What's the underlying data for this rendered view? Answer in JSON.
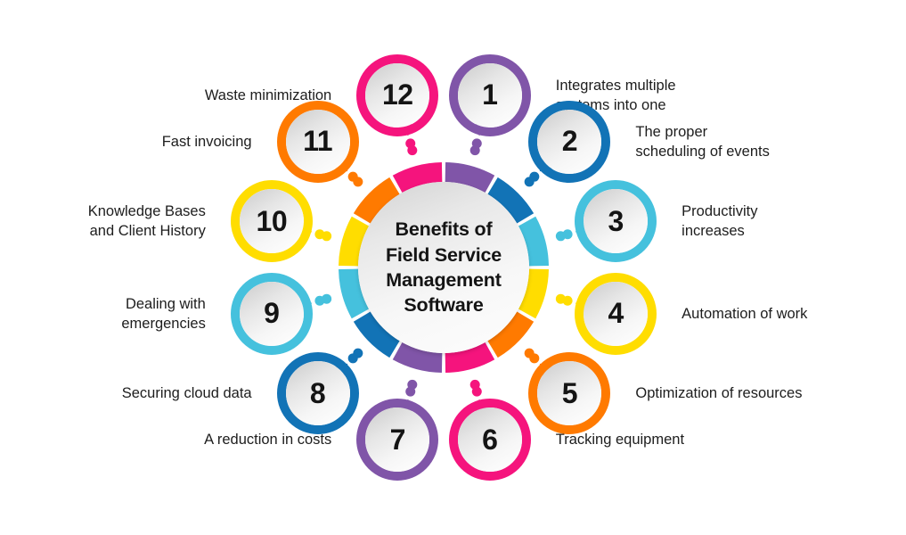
{
  "diagram": {
    "title_lines": "Benefits of\nField Service\nManagement\nSoftware",
    "palette": {
      "purple": "#8055a8",
      "blue": "#1273b6",
      "cyan": "#45c1dd",
      "yellow": "#ffdd00",
      "orange": "#ff7a00",
      "pink": "#f5147d"
    },
    "ring_segment_colors": [
      "#8055a8",
      "#1273b6",
      "#45c1dd",
      "#ffdd00",
      "#ff7a00",
      "#f5147d",
      "#8055a8",
      "#1273b6",
      "#45c1dd",
      "#ffdd00",
      "#ff7a00",
      "#f5147d"
    ],
    "items": [
      {
        "number": "1",
        "label": "Integrates multiple\nsystems into one",
        "color": "#8055a8",
        "side": "right"
      },
      {
        "number": "2",
        "label": "The proper\nscheduling of events",
        "color": "#1273b6",
        "side": "right"
      },
      {
        "number": "3",
        "label": "Productivity\nincreases",
        "color": "#45c1dd",
        "side": "right"
      },
      {
        "number": "4",
        "label": "Automation of work",
        "color": "#ffdd00",
        "side": "right"
      },
      {
        "number": "5",
        "label": "Optimization of resources",
        "color": "#ff7a00",
        "side": "right"
      },
      {
        "number": "6",
        "label": "Tracking equipment",
        "color": "#f5147d",
        "side": "right"
      },
      {
        "number": "7",
        "label": "A reduction in costs",
        "color": "#8055a8",
        "side": "left"
      },
      {
        "number": "8",
        "label": "Securing cloud data",
        "color": "#1273b6",
        "side": "left"
      },
      {
        "number": "9",
        "label": "Dealing with\nemergencies",
        "color": "#45c1dd",
        "side": "left"
      },
      {
        "number": "10",
        "label": "Knowledge Bases\nand Client History",
        "color": "#ffdd00",
        "side": "left"
      },
      {
        "number": "11",
        "label": "Fast invoicing",
        "color": "#ff7a00",
        "side": "left"
      },
      {
        "number": "12",
        "label": "Waste minimization",
        "color": "#f5147d",
        "side": "left"
      }
    ]
  }
}
